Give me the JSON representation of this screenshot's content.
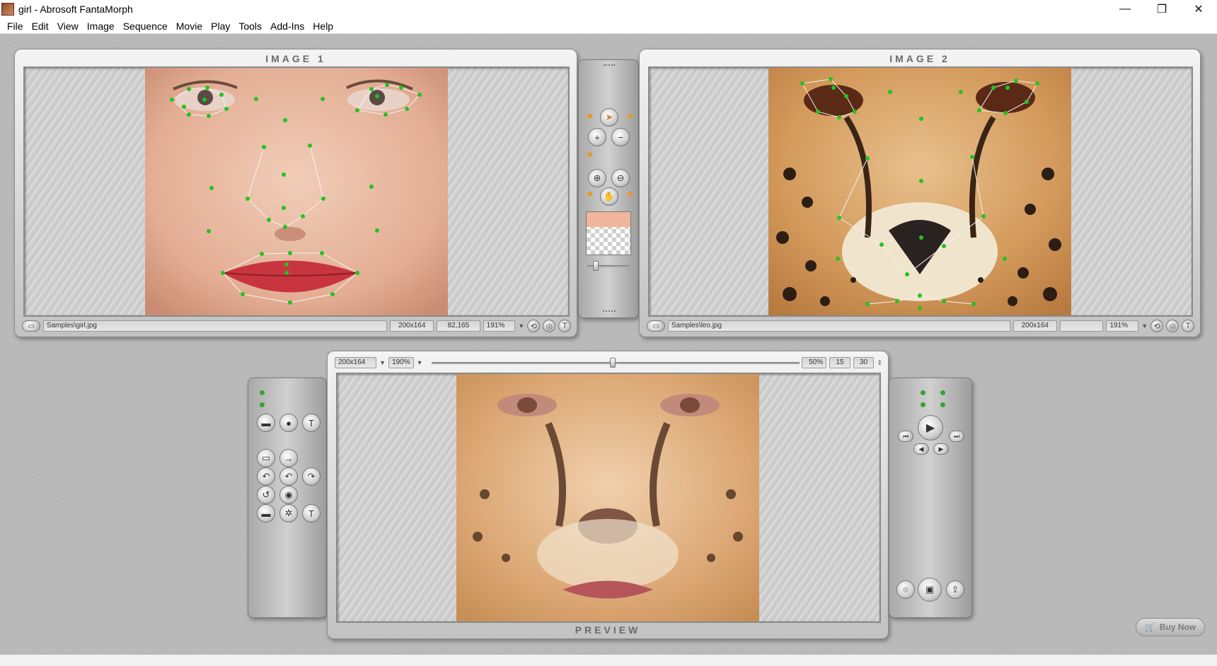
{
  "window": {
    "title": "girl - Abrosoft FantaMorph",
    "minimize": "—",
    "maximize": "❐",
    "close": "✕"
  },
  "menu": [
    "File",
    "Edit",
    "View",
    "Image",
    "Sequence",
    "Movie",
    "Play",
    "Tools",
    "Add-Ins",
    "Help"
  ],
  "image1": {
    "title": "IMAGE 1",
    "path": "Samples\\girl.jpg",
    "size": "200x164",
    "coords": "82,165",
    "zoom": "191%"
  },
  "image2": {
    "title": "IMAGE 2",
    "path": "Samples\\leo.jpg",
    "size": "200x164",
    "coords": "",
    "zoom": "191%"
  },
  "preview": {
    "title": "PREVIEW",
    "size": "200x164",
    "zoom": "190%",
    "percent": "50%",
    "frame": "15",
    "total": "30",
    "position": 0.5
  },
  "buy_now": "Buy Now",
  "colors": {
    "keypoint": "#22c322",
    "accent_orange": "#e39a2d"
  }
}
